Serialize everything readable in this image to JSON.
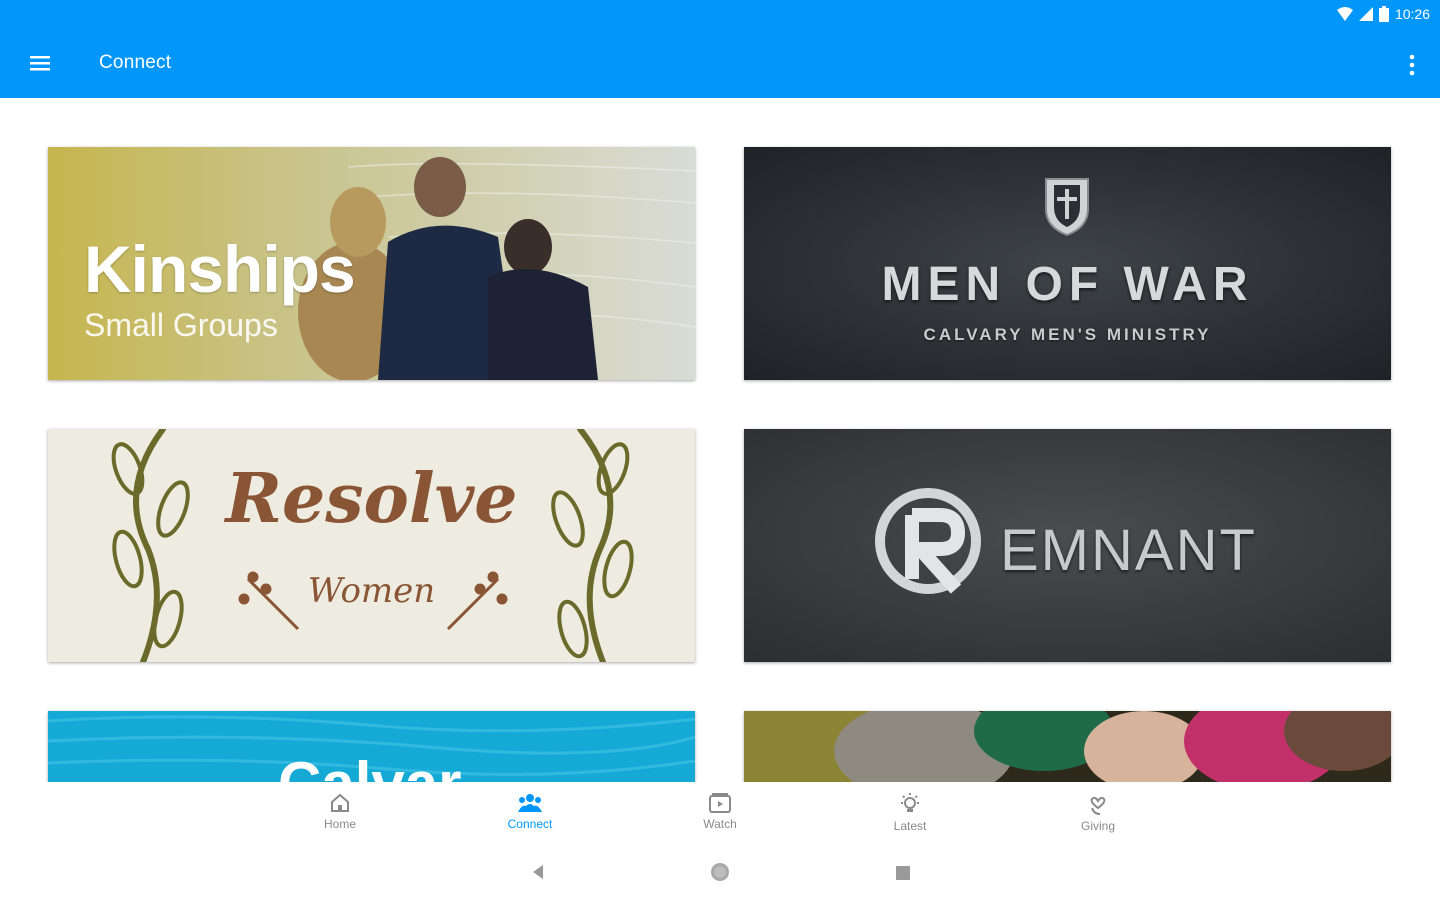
{
  "status_bar": {
    "time": "10:26"
  },
  "app_bar": {
    "title": "Connect",
    "menu_icon": "hamburger-menu-icon",
    "overflow_icon": "more-vert-icon"
  },
  "cards": [
    {
      "id": "kinships",
      "title": "Kinships",
      "subtitle": "Small Groups"
    },
    {
      "id": "men-of-war",
      "title": "MEN OF WAR",
      "subtitle": "CALVARY MEN'S MINISTRY"
    },
    {
      "id": "resolve",
      "title": "Resolve",
      "subtitle": "Women"
    },
    {
      "id": "remnant",
      "title": "EMNANT"
    },
    {
      "id": "calvary",
      "title": "Calvar"
    },
    {
      "id": "photo",
      "title": ""
    }
  ],
  "bottom_nav": {
    "active": "Connect",
    "accent": "#0096fa",
    "items": [
      {
        "label": "Home",
        "icon": "home-icon"
      },
      {
        "label": "Connect",
        "icon": "people-icon"
      },
      {
        "label": "Watch",
        "icon": "play-icon"
      },
      {
        "label": "Latest",
        "icon": "lightbulb-icon"
      },
      {
        "label": "Giving",
        "icon": "hand-heart-icon"
      }
    ]
  },
  "colors": {
    "primary": "#0096fa",
    "inactive": "#8a8a8a"
  }
}
